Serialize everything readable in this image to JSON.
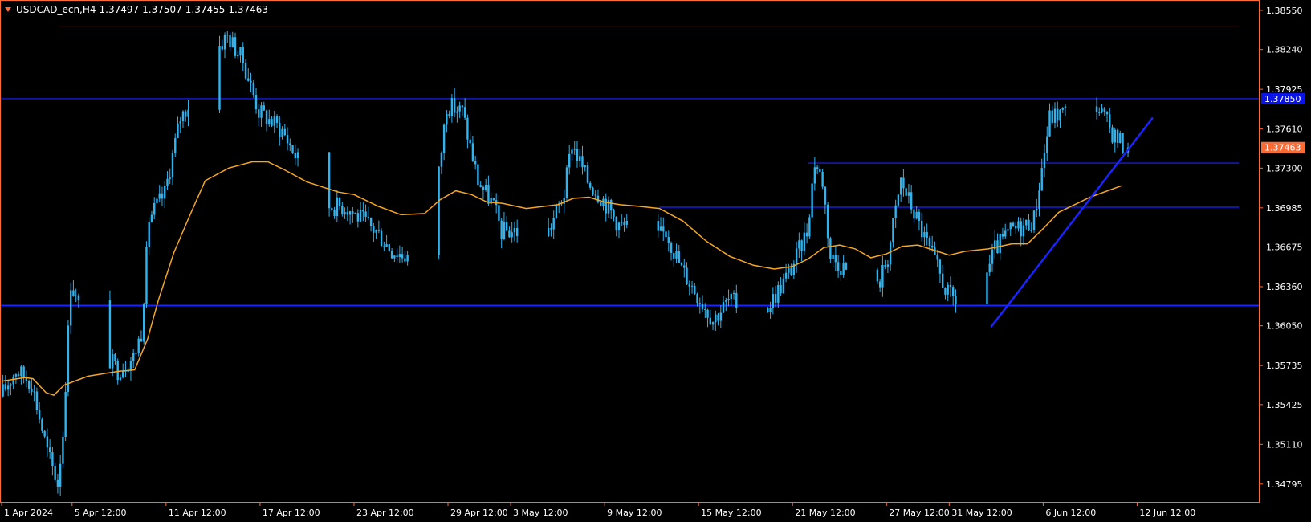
{
  "header": {
    "symbol": "USDCAD_ecn,H4",
    "open": "1.37497",
    "high": "1.37507",
    "low": "1.37455",
    "close": "1.37463"
  },
  "colors": {
    "background": "#000000",
    "frame": "#ff6a33",
    "candle": "#2fb4f0",
    "ma": "#f5a623",
    "support_resistance": "#1a24ff",
    "top_line": "#e00000",
    "price_tag": "#ff6a33",
    "line_tag": "#0a14e6"
  },
  "chart_data": {
    "type": "candlestick",
    "symbol": "USDCAD_ecn",
    "timeframe": "H4",
    "y_ticks": [
      "1.38550",
      "1.38240",
      "1.37925",
      "1.37610",
      "1.37300",
      "1.36985",
      "1.36675",
      "1.36360",
      "1.36050",
      "1.35735",
      "1.35425",
      "1.35110",
      "1.34795"
    ],
    "x_ticks": [
      "1 Apr 2024",
      "5 Apr 12:00",
      "11 Apr 12:00",
      "17 Apr 12:00",
      "23 Apr 12:00",
      "29 Apr 12:00",
      "3 May 12:00",
      "9 May 12:00",
      "15 May 12:00",
      "21 May 12:00",
      "27 May 12:00",
      "31 May 12:00",
      "6 Jun 12:00",
      "12 Jun 12:00"
    ],
    "ylim": [
      1.3466,
      1.3862
    ],
    "x_range": [
      "1 Apr 2024 00:00",
      "20 Jun 2024 04:00"
    ],
    "current_price": "1.37463",
    "horizontal_lines": [
      {
        "price": 1.3842,
        "color": "#e00000",
        "from": "4 Apr 2024 16:00",
        "to": "19 Jun 2024 00:00"
      },
      {
        "price": 1.3785,
        "color": "#1a24ff",
        "tag": "1.37850",
        "full_width": true
      },
      {
        "price": 1.3734,
        "color": "#1a24ff",
        "from": "22 May 2024 12:00",
        "to": "19 Jun 2024 00:00"
      },
      {
        "price": 1.3699,
        "color": "#1a24ff",
        "from": "13 May 2024 00:00",
        "to": "19 Jun 2024 00:00"
      },
      {
        "price": 1.3621,
        "color": "#1a24ff",
        "full_width": true
      }
    ],
    "trendline": {
      "from": [
        "3 Jun 2024 04:00",
        1.3604
      ],
      "to": [
        "13 Jun 2024 12:00",
        1.377
      ],
      "color": "#1a24ff"
    },
    "ma_points": [
      [
        "1 Apr 2024 00:00",
        1.3561
      ],
      [
        "2 Apr 2024 12:00",
        1.3564
      ],
      [
        "3 Apr 2024 00:00",
        1.3563
      ],
      [
        "3 Apr 2024 20:00",
        1.3552
      ],
      [
        "4 Apr 2024 08:00",
        1.355
      ],
      [
        "5 Apr 2024 00:00",
        1.3558
      ],
      [
        "6 Apr 2024 12:00",
        1.3565
      ],
      [
        "8 Apr 2024 12:00",
        1.3569
      ],
      [
        "9 Apr 2024 12:00",
        1.357
      ],
      [
        "10 Apr 2024 08:00",
        1.3595
      ],
      [
        "11 Apr 2024 00:00",
        1.3625
      ],
      [
        "12 Apr 2024 00:00",
        1.3663
      ],
      [
        "13 Apr 2024 00:00",
        1.3692
      ],
      [
        "14 Apr 2024 00:00",
        1.372
      ],
      [
        "15 Apr 2024 12:00",
        1.373
      ],
      [
        "17 Apr 2024 00:00",
        1.3735
      ],
      [
        "18 Apr 2024 00:00",
        1.3735
      ],
      [
        "19 Apr 2024 00:00",
        1.3729
      ],
      [
        "20 Apr 2024 12:00",
        1.3719
      ],
      [
        "22 Apr 2024 12:00",
        1.3711
      ],
      [
        "23 Apr 2024 12:00",
        1.3709
      ],
      [
        "25 Apr 2024 00:00",
        1.37
      ],
      [
        "26 Apr 2024 12:00",
        1.3693
      ],
      [
        "28 Apr 2024 00:00",
        1.3694
      ],
      [
        "29 Apr 2024 00:00",
        1.3705
      ],
      [
        "30 Apr 2024 00:00",
        1.3712
      ],
      [
        "1 May 2024 00:00",
        1.3709
      ],
      [
        "2 May 2024 00:00",
        1.3703
      ],
      [
        "3 May 2024 00:00",
        1.3702
      ],
      [
        "4 May 2024 12:00",
        1.3698
      ],
      [
        "6 May 2024 12:00",
        1.3701
      ],
      [
        "7 May 2024 12:00",
        1.3706
      ],
      [
        "8 May 2024 12:00",
        1.3707
      ],
      [
        "9 May 2024 12:00",
        1.3703
      ],
      [
        "10 May 2024 12:00",
        1.3701
      ],
      [
        "11 May 2024 12:00",
        1.37
      ],
      [
        "13 May 2024 00:00",
        1.3698
      ],
      [
        "14 May 2024 12:00",
        1.3688
      ],
      [
        "16 May 2024 00:00",
        1.3672
      ],
      [
        "17 May 2024 12:00",
        1.366
      ],
      [
        "19 May 2024 00:00",
        1.3653
      ],
      [
        "20 May 2024 08:00",
        1.365
      ],
      [
        "21 May 2024 12:00",
        1.3652
      ],
      [
        "22 May 2024 12:00",
        1.3658
      ],
      [
        "23 May 2024 12:00",
        1.3667
      ],
      [
        "24 May 2024 12:00",
        1.3669
      ],
      [
        "25 May 2024 12:00",
        1.3666
      ],
      [
        "26 May 2024 12:00",
        1.3659
      ],
      [
        "27 May 2024 12:00",
        1.3662
      ],
      [
        "28 May 2024 12:00",
        1.3668
      ],
      [
        "29 May 2024 12:00",
        1.3669
      ],
      [
        "30 May 2024 12:00",
        1.3665
      ],
      [
        "31 May 2024 12:00",
        1.3661
      ],
      [
        "1 Jun 2024 12:00",
        1.3664
      ],
      [
        "3 Jun 2024 00:00",
        1.3666
      ],
      [
        "4 Jun 2024 12:00",
        1.367
      ],
      [
        "5 Jun 2024 12:00",
        1.367
      ],
      [
        "6 Jun 2024 12:00",
        1.3682
      ],
      [
        "7 Jun 2024 12:00",
        1.3695
      ],
      [
        "9 Jun 2024 12:00",
        1.3707
      ],
      [
        "11 Jun 2024 12:00",
        1.3716
      ]
    ],
    "price_path": [
      [
        "1 Apr 2024 00:00",
        1.3549
      ],
      [
        "2 Apr 2024 00:00",
        1.357
      ],
      [
        "3 Apr 2024 00:00",
        1.356
      ],
      [
        "4 Apr 2024 00:00",
        1.3505
      ],
      [
        "4 Apr 2024 16:00",
        1.348
      ],
      [
        "5 Apr 2024 00:00",
        1.352
      ],
      [
        "5 Apr 2024 12:00",
        1.364
      ],
      [
        "6 Apr 2024 12:00",
        1.36
      ],
      [
        "8 Apr 2024 12:00",
        1.357
      ],
      [
        "9 Apr 2024 12:00",
        1.358
      ],
      [
        "10 Apr 2024 00:00",
        1.36
      ],
      [
        "10 Apr 2024 12:00",
        1.369
      ],
      [
        "11 Apr 2024 12:00",
        1.371
      ],
      [
        "12 Apr 2024 12:00",
        1.377
      ],
      [
        "13 Apr 2024 12:00",
        1.379
      ],
      [
        "14 Apr 2024 12:00",
        1.382
      ],
      [
        "15 Apr 2024 12:00",
        1.3835
      ],
      [
        "16 Apr 2024 12:00",
        1.3815
      ],
      [
        "17 Apr 2024 12:00",
        1.3775
      ],
      [
        "18 Apr 2024 00:00",
        1.377
      ],
      [
        "19 Apr 2024 00:00",
        1.376
      ],
      [
        "20 Apr 2024 12:00",
        1.3725
      ],
      [
        "22 Apr 2024 00:00",
        1.37
      ],
      [
        "23 Apr 2024 00:00",
        1.37
      ],
      [
        "24 Apr 2024 00:00",
        1.369
      ],
      [
        "25 Apr 2024 00:00",
        1.368
      ],
      [
        "26 Apr 2024 00:00",
        1.3665
      ],
      [
        "27 Apr 2024 00:00",
        1.366
      ],
      [
        "28 Apr 2024 00:00",
        1.366
      ],
      [
        "28 Apr 2024 16:00",
        1.369
      ],
      [
        "29 Apr 2024 12:00",
        1.378
      ],
      [
        "30 Apr 2024 12:00",
        1.3775
      ],
      [
        "1 May 2024 12:00",
        1.372
      ],
      [
        "2 May 2024 12:00",
        1.37
      ],
      [
        "3 May 2024 00:00",
        1.368
      ],
      [
        "4 May 2024 00:00",
        1.368
      ],
      [
        "5 May 2024 00:00",
        1.367
      ],
      [
        "6 May 2024 00:00",
        1.368
      ],
      [
        "7 May 2024 00:00",
        1.371
      ],
      [
        "7 May 2024 12:00",
        1.375
      ],
      [
        "8 May 2024 12:00",
        1.372
      ],
      [
        "9 May 2024 12:00",
        1.3705
      ],
      [
        "10 May 2024 12:00",
        1.3685
      ],
      [
        "11 May 2024 12:00",
        1.368
      ],
      [
        "12 May 2024 12:00",
        1.367
      ],
      [
        "13 May 2024 12:00",
        1.368
      ],
      [
        "14 May 2024 12:00",
        1.365
      ],
      [
        "15 May 2024 12:00",
        1.363
      ],
      [
        "16 May 2024 12:00",
        1.361
      ],
      [
        "17 May 2024 12:00",
        1.3625
      ],
      [
        "18 May 2024 12:00",
        1.362
      ],
      [
        "19 May 2024 12:00",
        1.361
      ],
      [
        "20 May 2024 12:00",
        1.363
      ],
      [
        "21 May 2024 12:00",
        1.365
      ],
      [
        "22 May 2024 12:00",
        1.368
      ],
      [
        "23 May 2024 00:00",
        1.3735
      ],
      [
        "23 May 2024 12:00",
        1.372
      ],
      [
        "24 May 2024 00:00",
        1.366
      ],
      [
        "25 May 2024 00:00",
        1.365
      ],
      [
        "26 May 2024 00:00",
        1.363
      ],
      [
        "27 May 2024 00:00",
        1.3635
      ],
      [
        "27 May 2024 16:00",
        1.366
      ],
      [
        "28 May 2024 12:00",
        1.372
      ],
      [
        "29 May 2024 12:00",
        1.369
      ],
      [
        "30 May 2024 12:00",
        1.366
      ],
      [
        "31 May 2024 12:00",
        1.363
      ],
      [
        "1 Jun 2024 12:00",
        1.362
      ],
      [
        "2 Jun 2024 12:00",
        1.363
      ],
      [
        "3 Jun 2024 12:00",
        1.3665
      ],
      [
        "4 Jun 2024 12:00",
        1.368
      ],
      [
        "5 Jun 2024 12:00",
        1.3685
      ],
      [
        "6 Jun 2024 00:00",
        1.369
      ],
      [
        "6 Jun 2024 12:00",
        1.373
      ],
      [
        "7 Jun 2024 00:00",
        1.377
      ],
      [
        "8 Jun 2024 00:00",
        1.3775
      ],
      [
        "9 Jun 2024 00:00",
        1.377
      ],
      [
        "10 Jun 2024 00:00",
        1.378
      ],
      [
        "11 Jun 2024 00:00",
        1.3758
      ],
      [
        "11 Jun 2024 20:00",
        1.37463
      ]
    ]
  }
}
